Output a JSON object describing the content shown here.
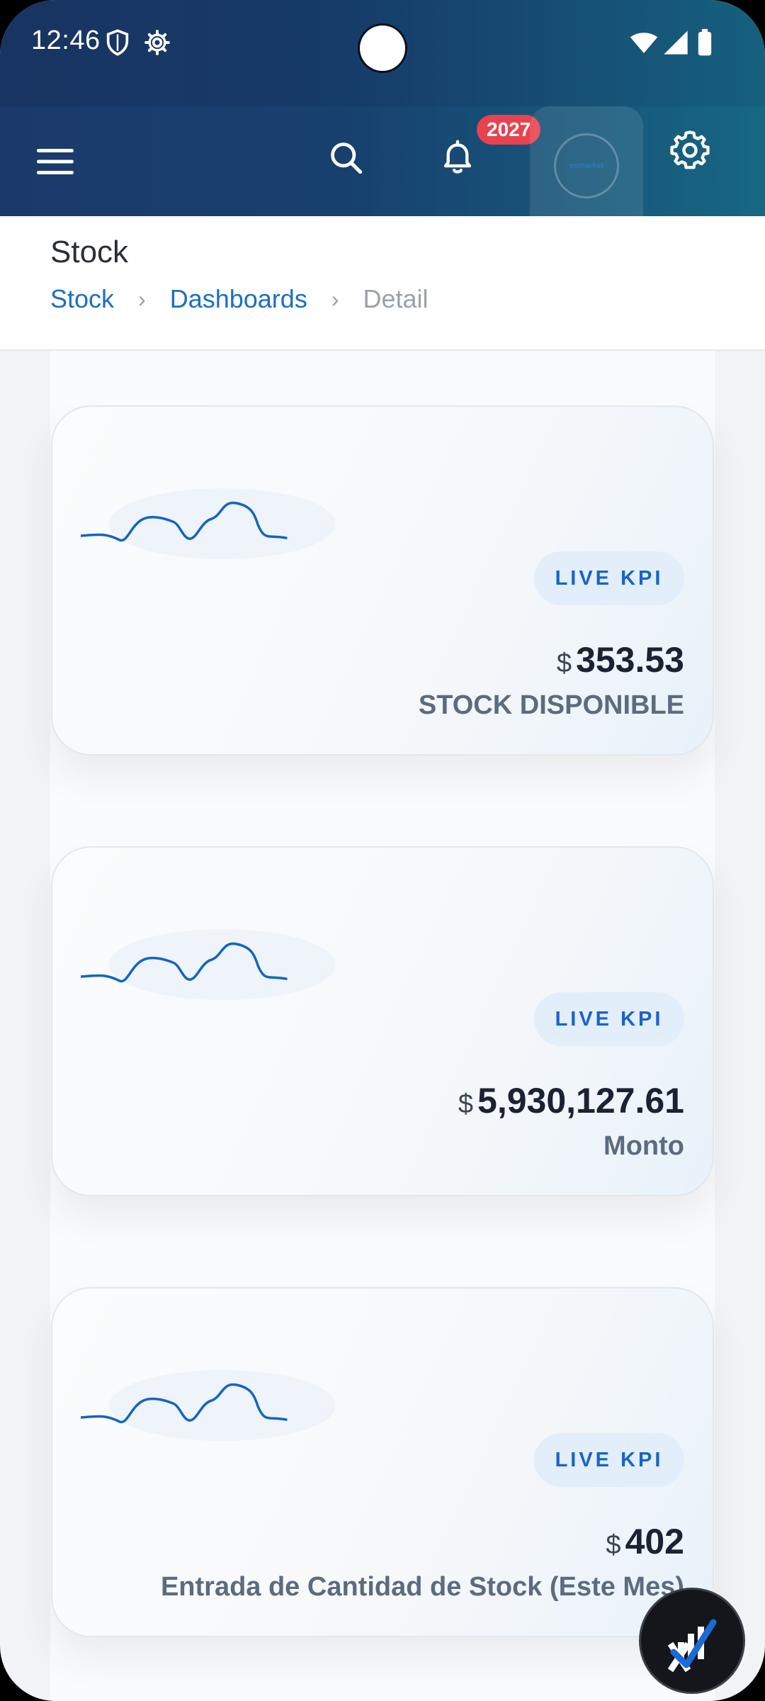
{
  "status_bar": {
    "time": "12:46",
    "icons": [
      "shield-icon",
      "gear-icon",
      "wifi-icon",
      "signal-icon",
      "battery-icon"
    ]
  },
  "app_bar": {
    "icons": [
      "menu-icon",
      "search-icon",
      "bell-icon",
      "gear-icon"
    ],
    "notification_count": "2027",
    "avatar_text": "ssmarket"
  },
  "page": {
    "title": "Stock",
    "breadcrumb": [
      {
        "label": "Stock",
        "link": true
      },
      {
        "label": "Dashboards",
        "link": true
      },
      {
        "label": "Detail",
        "link": false
      }
    ],
    "separator": "›"
  },
  "cards": [
    {
      "pill": "LIVE KPI",
      "currency": "$",
      "value": "353.53",
      "label": "STOCK DISPONIBLE"
    },
    {
      "pill": "LIVE KPI",
      "currency": "$",
      "value": "5,930,127.61",
      "label": "Monto"
    },
    {
      "pill": "LIVE KPI",
      "currency": "$",
      "value": "402",
      "label": "Entrada de Cantidad de Stock (Este Mes)"
    }
  ],
  "colors": {
    "accent": "#1c6fc2",
    "badge": "#e8424f",
    "sparkline": "#1a63c9"
  }
}
